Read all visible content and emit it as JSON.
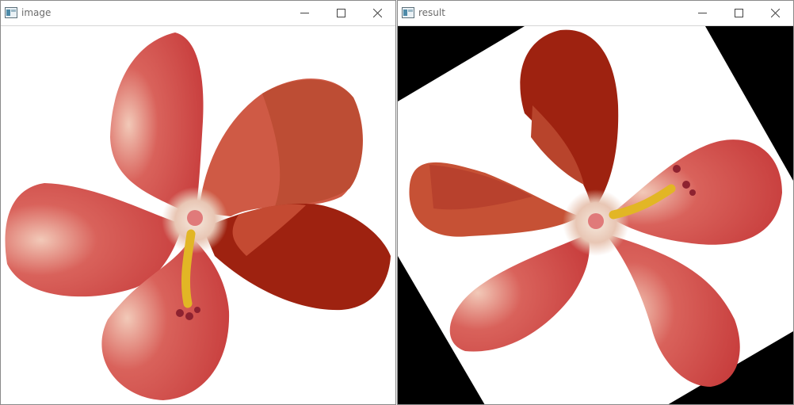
{
  "windows": [
    {
      "title": "image",
      "controls": [
        "minimize-icon",
        "maximize-icon",
        "close-icon"
      ]
    },
    {
      "title": "result",
      "controls": [
        "minimize-icon",
        "maximize-icon",
        "close-icon"
      ]
    }
  ],
  "colors": {
    "petal": "#cf4a44",
    "petal_dark": "#9e2210",
    "petal_mid": "#c65135",
    "pollen": "#e2b625",
    "center": "#f2e6d6",
    "border": "#000000"
  }
}
